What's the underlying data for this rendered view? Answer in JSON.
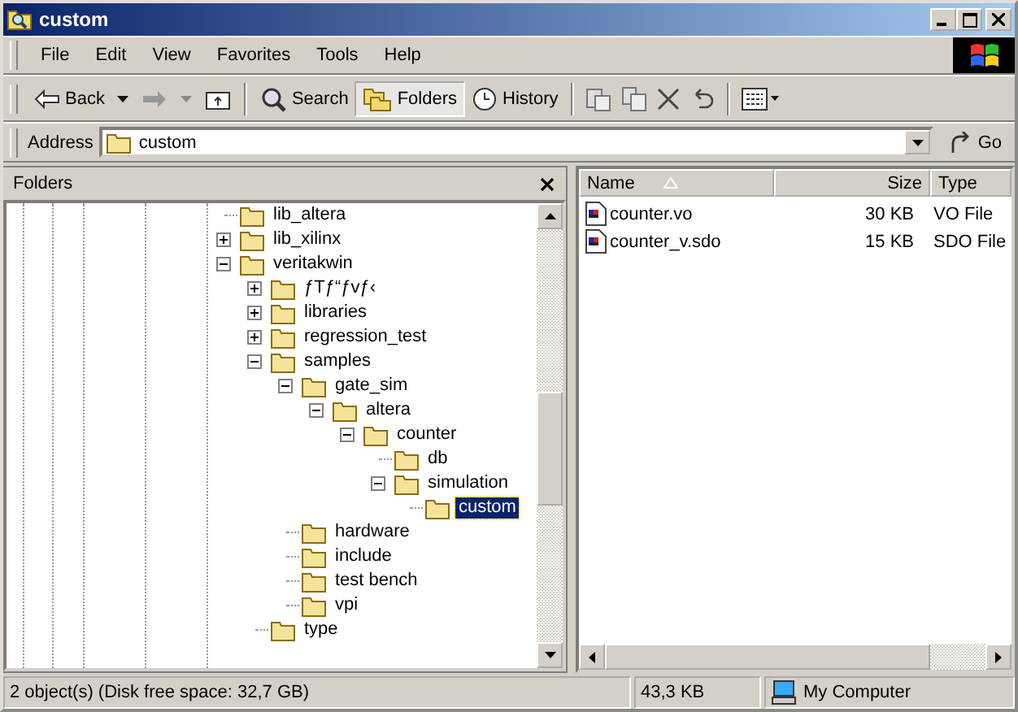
{
  "window": {
    "title": "custom"
  },
  "menu": [
    "File",
    "Edit",
    "View",
    "Favorites",
    "Tools",
    "Help"
  ],
  "toolbar": {
    "back": "Back",
    "forward_enabled": false,
    "buttons": [
      {
        "label": "Search",
        "kind": "search",
        "selected": false
      },
      {
        "label": "Folders",
        "kind": "folders",
        "selected": true
      },
      {
        "label": "History",
        "kind": "history",
        "selected": false
      }
    ]
  },
  "address": {
    "label": "Address",
    "value": "custom",
    "go": "Go"
  },
  "folders_pane": {
    "title": "Folders",
    "tree": [
      {
        "label": "lib_altera",
        "selected": false
      },
      {
        "label": "lib_xilinx",
        "expanded": false,
        "selected": false
      },
      {
        "label": "veritakwin",
        "expanded": true,
        "selected": false,
        "children": [
          {
            "label": "ƒTƒ“ƒvƒ‹",
            "expanded": false,
            "selected": false
          },
          {
            "label": "libraries",
            "expanded": false,
            "selected": false
          },
          {
            "label": "regression_test",
            "expanded": false,
            "selected": false
          },
          {
            "label": "samples",
            "expanded": true,
            "selected": false,
            "children": [
              {
                "label": "gate_sim",
                "expanded": true,
                "selected": false,
                "children": [
                  {
                    "label": "altera",
                    "expanded": true,
                    "selected": false,
                    "children": [
                      {
                        "label": "counter",
                        "expanded": true,
                        "selected": false,
                        "children": [
                          {
                            "label": "db",
                            "selected": false
                          },
                          {
                            "label": "simulation",
                            "expanded": true,
                            "selected": false,
                            "children": [
                              {
                                "label": "custom",
                                "selected": true
                              }
                            ]
                          }
                        ]
                      }
                    ]
                  }
                ]
              },
              {
                "label": "hardware",
                "selected": false
              },
              {
                "label": "include",
                "selected": false
              },
              {
                "label": "test bench",
                "selected": false
              },
              {
                "label": "vpi",
                "selected": false
              }
            ]
          },
          {
            "label": "type",
            "selected": false
          }
        ]
      }
    ]
  },
  "files": {
    "columns": [
      "Name",
      "Size",
      "Type"
    ],
    "rows": [
      {
        "name": "counter.vo",
        "size": "30 KB",
        "type": "VO File"
      },
      {
        "name": "counter_v.sdo",
        "size": "15 KB",
        "type": "SDO File"
      }
    ]
  },
  "status_bar": {
    "objects": "2 object(s) (Disk free space: 32,7 GB)",
    "size": "43,3 KB",
    "zone": "My Computer"
  }
}
